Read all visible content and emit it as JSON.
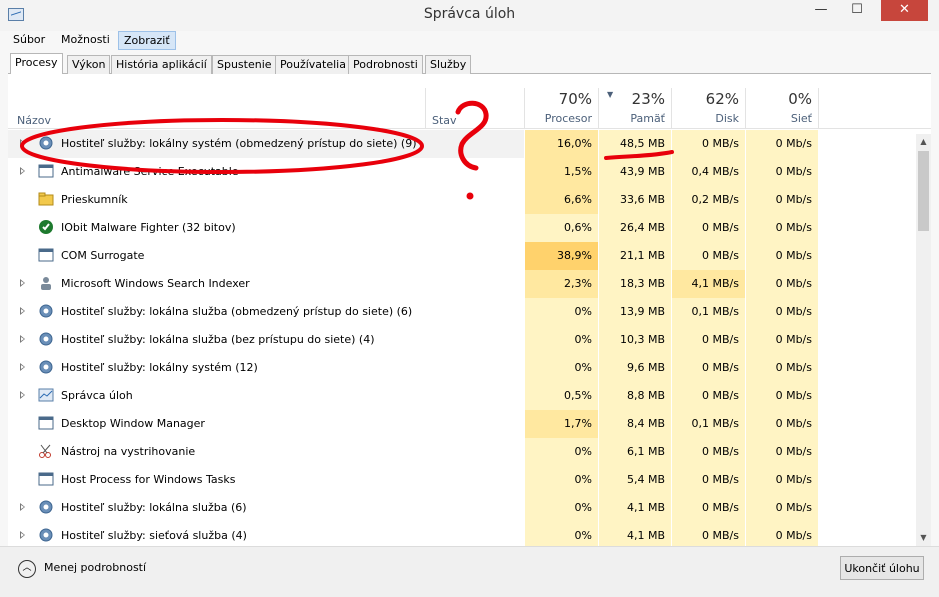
{
  "window": {
    "title": "Správca úloh",
    "minimize": "—",
    "maximize": "☐",
    "close": "✕"
  },
  "menu": [
    "Súbor",
    "Možnosti",
    "Zobraziť"
  ],
  "tabs": [
    "Procesy",
    "Výkon",
    "História aplikácií",
    "Spustenie",
    "Používatelia",
    "Podrobnosti",
    "Služby"
  ],
  "headers": {
    "name": "Názov",
    "status": "Stav",
    "cpu": {
      "pct": "70%",
      "label": "Procesor"
    },
    "memory": {
      "pct": "23%",
      "label": "Pamäť"
    },
    "disk": {
      "pct": "62%",
      "label": "Disk"
    },
    "network": {
      "pct": "0%",
      "label": "Sieť"
    }
  },
  "processes": [
    {
      "name": "Hostiteľ služby: lokálny systém (obmedzený prístup do siete) (9)",
      "icon": "gear-icon",
      "expandable": true,
      "cpu": "16,0%",
      "mem": "48,5 MB",
      "disk": "0 MB/s",
      "net": "0 Mb/s"
    },
    {
      "name": "Antimalware Service Executable",
      "icon": "window-icon",
      "expandable": true,
      "cpu": "1,5%",
      "mem": "43,9 MB",
      "disk": "0,4 MB/s",
      "net": "0 Mb/s"
    },
    {
      "name": "Prieskumník",
      "icon": "folder-icon",
      "expandable": false,
      "cpu": "6,6%",
      "mem": "33,6 MB",
      "disk": "0,2 MB/s",
      "net": "0 Mb/s"
    },
    {
      "name": "IObit Malware Fighter (32 bitov)",
      "icon": "shield-icon",
      "expandable": false,
      "cpu": "0,6%",
      "mem": "26,4 MB",
      "disk": "0 MB/s",
      "net": "0 Mb/s"
    },
    {
      "name": "COM Surrogate",
      "icon": "window-icon",
      "expandable": false,
      "cpu": "38,9%",
      "mem": "21,1 MB",
      "disk": "0 MB/s",
      "net": "0 Mb/s"
    },
    {
      "name": "Microsoft Windows Search Indexer",
      "icon": "search-user-icon",
      "expandable": true,
      "cpu": "2,3%",
      "mem": "18,3 MB",
      "disk": "4,1 MB/s",
      "net": "0 Mb/s"
    },
    {
      "name": "Hostiteľ služby: lokálna služba (obmedzený prístup do siete) (6)",
      "icon": "gear-icon",
      "expandable": true,
      "cpu": "0%",
      "mem": "13,9 MB",
      "disk": "0,1 MB/s",
      "net": "0 Mb/s"
    },
    {
      "name": "Hostiteľ služby: lokálna služba (bez prístupu do siete) (4)",
      "icon": "gear-icon",
      "expandable": true,
      "cpu": "0%",
      "mem": "10,3 MB",
      "disk": "0 MB/s",
      "net": "0 Mb/s"
    },
    {
      "name": "Hostiteľ služby: lokálny systém (12)",
      "icon": "gear-icon",
      "expandable": true,
      "cpu": "0%",
      "mem": "9,6 MB",
      "disk": "0 MB/s",
      "net": "0 Mb/s"
    },
    {
      "name": "Správca úloh",
      "icon": "taskmgr-icon",
      "expandable": true,
      "cpu": "0,5%",
      "mem": "8,8 MB",
      "disk": "0 MB/s",
      "net": "0 Mb/s"
    },
    {
      "name": "Desktop Window Manager",
      "icon": "window-icon",
      "expandable": false,
      "cpu": "1,7%",
      "mem": "8,4 MB",
      "disk": "0,1 MB/s",
      "net": "0 Mb/s"
    },
    {
      "name": "Nástroj na vystrihovanie",
      "icon": "scissors-icon",
      "expandable": false,
      "cpu": "0%",
      "mem": "6,1 MB",
      "disk": "0 MB/s",
      "net": "0 Mb/s"
    },
    {
      "name": "Host Process for Windows Tasks",
      "icon": "window-icon",
      "expandable": false,
      "cpu": "0%",
      "mem": "5,4 MB",
      "disk": "0 MB/s",
      "net": "0 Mb/s"
    },
    {
      "name": "Hostiteľ služby: lokálna služba (6)",
      "icon": "gear-icon",
      "expandable": true,
      "cpu": "0%",
      "mem": "4,1 MB",
      "disk": "0 MB/s",
      "net": "0 Mb/s"
    },
    {
      "name": "Hostiteľ služby: sieťová služba (4)",
      "icon": "gear-icon",
      "expandable": true,
      "cpu": "0%",
      "mem": "4,1 MB",
      "disk": "0 MB/s",
      "net": "0 Mb/s"
    }
  ],
  "footer": {
    "less_details": "Menej podrobností",
    "end_task": "Ukončiť úlohu"
  },
  "colors": {
    "heat_low": "#fff4c4",
    "heat_mid": "#ffe8a0",
    "heat_high": "#ffd26c",
    "selected": "#f2f2f2",
    "annotation": "#e8000b"
  }
}
